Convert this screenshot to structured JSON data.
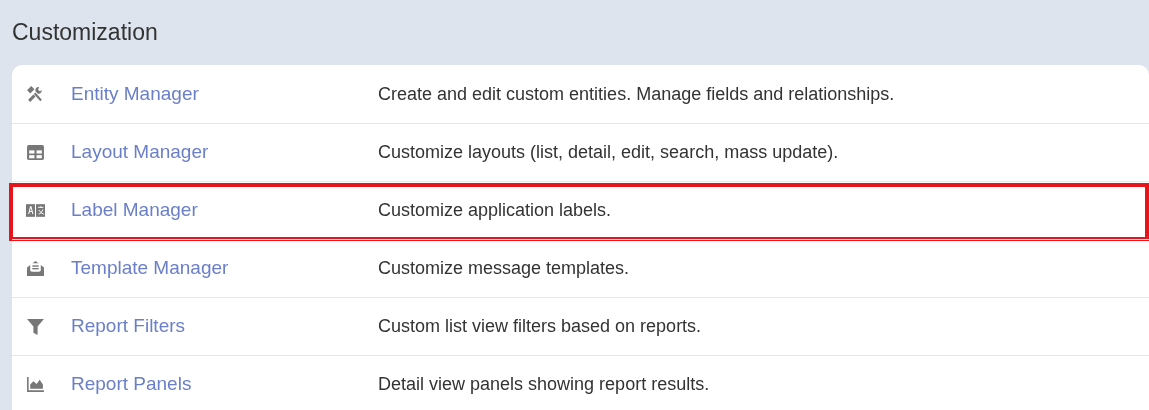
{
  "panel": {
    "title": "Customization"
  },
  "rows": [
    {
      "name": "Entity Manager",
      "description": "Create and edit custom entities. Manage fields and relationships.",
      "highlighted": false
    },
    {
      "name": "Layout Manager",
      "description": "Customize layouts (list, detail, edit, search, mass update).",
      "highlighted": false
    },
    {
      "name": "Label Manager",
      "description": "Customize application labels.",
      "highlighted": true
    },
    {
      "name": "Template Manager",
      "description": "Customize message templates.",
      "highlighted": false
    },
    {
      "name": "Report Filters",
      "description": "Custom list view filters based on reports.",
      "highlighted": false
    },
    {
      "name": "Report Panels",
      "description": "Detail view panels showing report results.",
      "highlighted": false
    }
  ]
}
